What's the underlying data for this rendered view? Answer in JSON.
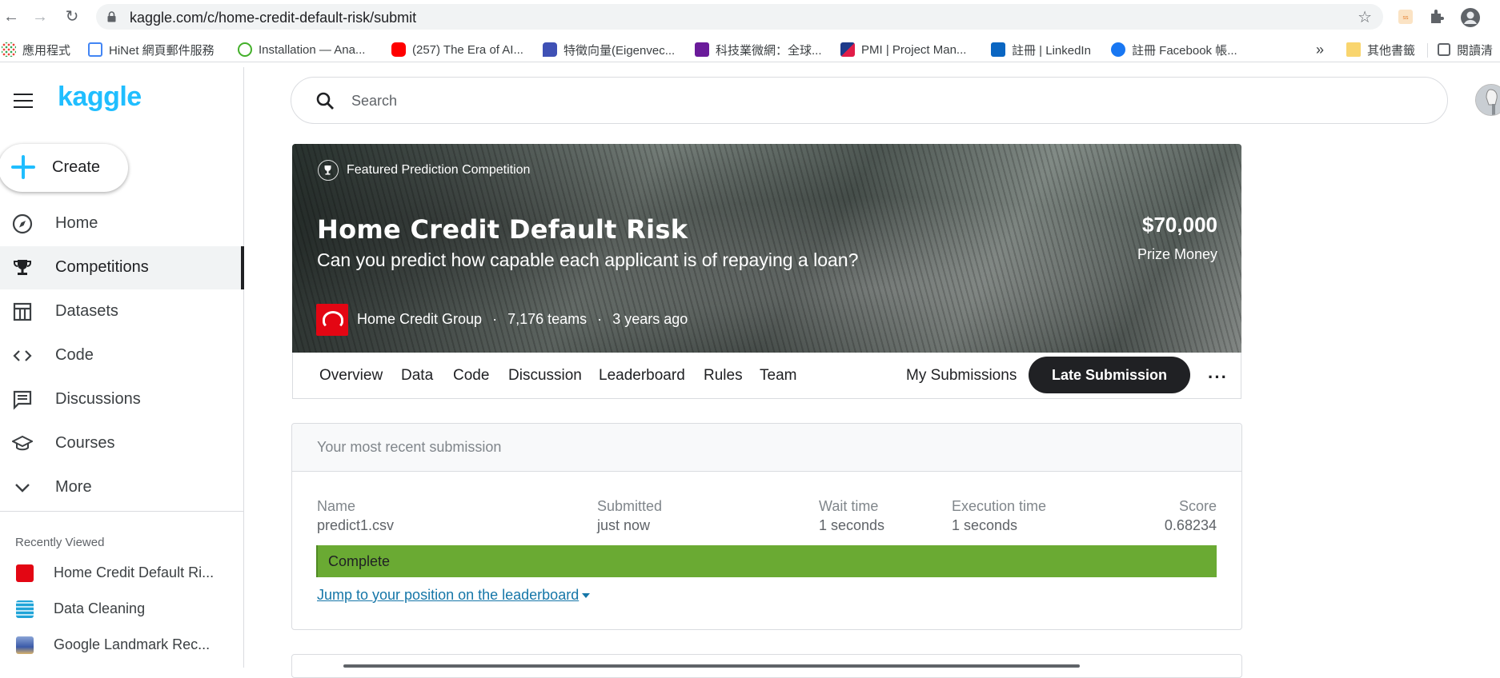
{
  "browser": {
    "url": "kaggle.com/c/home-credit-default-risk/submit",
    "bookmarks": [
      {
        "label": "應用程式",
        "color": "#ea4335"
      },
      {
        "label": "HiNet 網頁郵件服務",
        "color": "#4285f4"
      },
      {
        "label": "Installation — Ana...",
        "color": "#43b02a"
      },
      {
        "label": "(257) The Era of AI...",
        "color": "#ff0000"
      },
      {
        "label": "特徵向量(Eigenvec...",
        "color": "#3f51b5"
      },
      {
        "label": "科技業微網：全球...",
        "color": "#6a1b9a"
      },
      {
        "label": "PMI | Project Man...",
        "color": "#1e3a8a"
      },
      {
        "label": "註冊 | LinkedIn",
        "color": "#0a66c2"
      },
      {
        "label": "註冊 Facebook 帳...",
        "color": "#1877f2"
      }
    ],
    "overflow": "»",
    "other_bookmarks": "其他書籤",
    "reading_list": "閱讀清"
  },
  "sidebar": {
    "logo": "kaggle",
    "create_label": "Create",
    "items": [
      {
        "label": "Home",
        "icon": "compass-icon"
      },
      {
        "label": "Competitions",
        "icon": "trophy-icon"
      },
      {
        "label": "Datasets",
        "icon": "table-icon"
      },
      {
        "label": "Code",
        "icon": "code-icon"
      },
      {
        "label": "Discussions",
        "icon": "comment-icon"
      },
      {
        "label": "Courses",
        "icon": "school-icon"
      },
      {
        "label": "More",
        "icon": "chevron-down-icon"
      }
    ],
    "recently_viewed_title": "Recently Viewed",
    "recently_viewed": [
      {
        "label": "Home Credit Default Ri...",
        "color": "#e30613"
      },
      {
        "label": "Data Cleaning",
        "color": "#20a4d8"
      },
      {
        "label": "Google Landmark Rec...",
        "color": "#3b5aa8"
      }
    ]
  },
  "search": {
    "placeholder": "Search"
  },
  "competition": {
    "badge": "Featured Prediction Competition",
    "title": "Home Credit Default Risk",
    "subtitle": "Can you predict how capable each applicant is of repaying a loan?",
    "prize": "$70,000",
    "prize_label": "Prize Money",
    "host": "Home Credit Group",
    "teams": "7,176 teams",
    "age": "3 years ago",
    "meta_sep": "·"
  },
  "tabs": [
    "Overview",
    "Data",
    "Code",
    "Discussion",
    "Leaderboard",
    "Rules",
    "Team"
  ],
  "my_submissions": "My Submissions",
  "late_submission": "Late Submission",
  "more_menu": "···",
  "submission": {
    "header": "Your most recent submission",
    "columns": {
      "name": {
        "label": "Name",
        "value": "predict1.csv"
      },
      "submitted": {
        "label": "Submitted",
        "value": "just now"
      },
      "wait": {
        "label": "Wait time",
        "value": "1 seconds"
      },
      "execution": {
        "label": "Execution time",
        "value": "1 seconds"
      },
      "score": {
        "label": "Score",
        "value": "0.68234"
      }
    },
    "status": "Complete",
    "status_color": "#6aaa33",
    "jump_link": "Jump to your position on the leaderboard"
  }
}
